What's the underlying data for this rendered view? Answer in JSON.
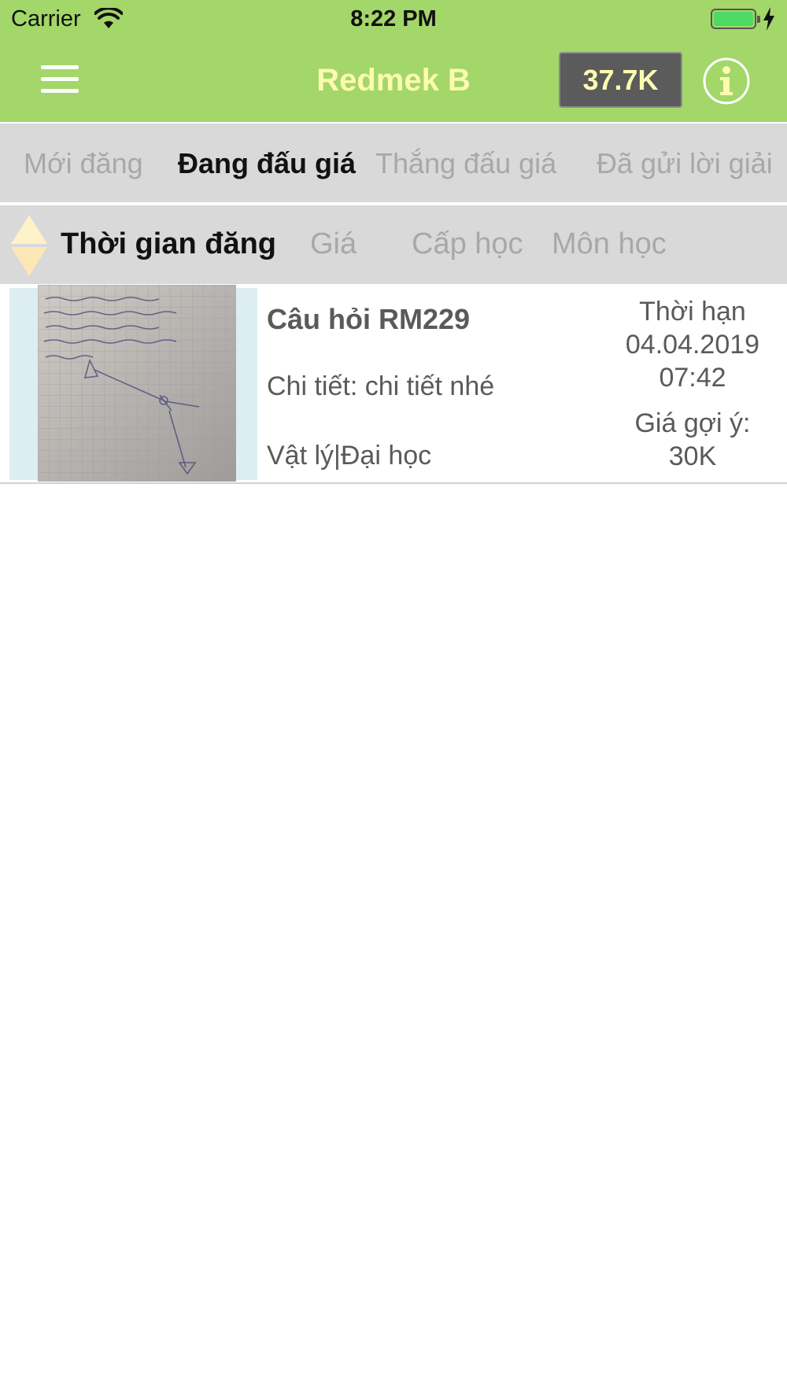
{
  "status_bar": {
    "carrier": "Carrier",
    "time": "8:22 PM",
    "wifi_icon": "wifi-icon",
    "battery_icon": "battery-icon",
    "charging_icon": "charging-bolt-icon"
  },
  "nav": {
    "title": "Redmek B",
    "balance": "37.7K",
    "menu_icon": "hamburger-menu-icon",
    "info_icon": "info-icon"
  },
  "tabs": [
    {
      "label": "Mới đăng",
      "active": false
    },
    {
      "label": "Đang đấu giá",
      "active": true
    },
    {
      "label": "Thắng đấu giá",
      "active": false
    },
    {
      "label": "Đã gửi lời giải",
      "active": false
    }
  ],
  "sort": {
    "icon": "sort-arrows-icon",
    "options": [
      {
        "label": "Thời gian đăng",
        "active": true
      },
      {
        "label": "Giá",
        "active": false
      },
      {
        "label": "Cấp học",
        "active": false
      },
      {
        "label": "Môn học",
        "active": false
      }
    ]
  },
  "items": [
    {
      "title": "Câu hỏi RM229",
      "detail": "Chi tiết: chi tiết nhé",
      "category": "Vật lý|Đại học",
      "deadline_label": "Thời hạn",
      "deadline_date": "04.04.2019",
      "deadline_time": "07:42",
      "price_label": "Giá gợi ý:",
      "price": "30K"
    }
  ],
  "colors": {
    "header_green": "#a3d769",
    "title_yellow": "#fdfbb0",
    "tab_bg": "#d9d9d9",
    "balance_bg": "#5b5b5b"
  }
}
